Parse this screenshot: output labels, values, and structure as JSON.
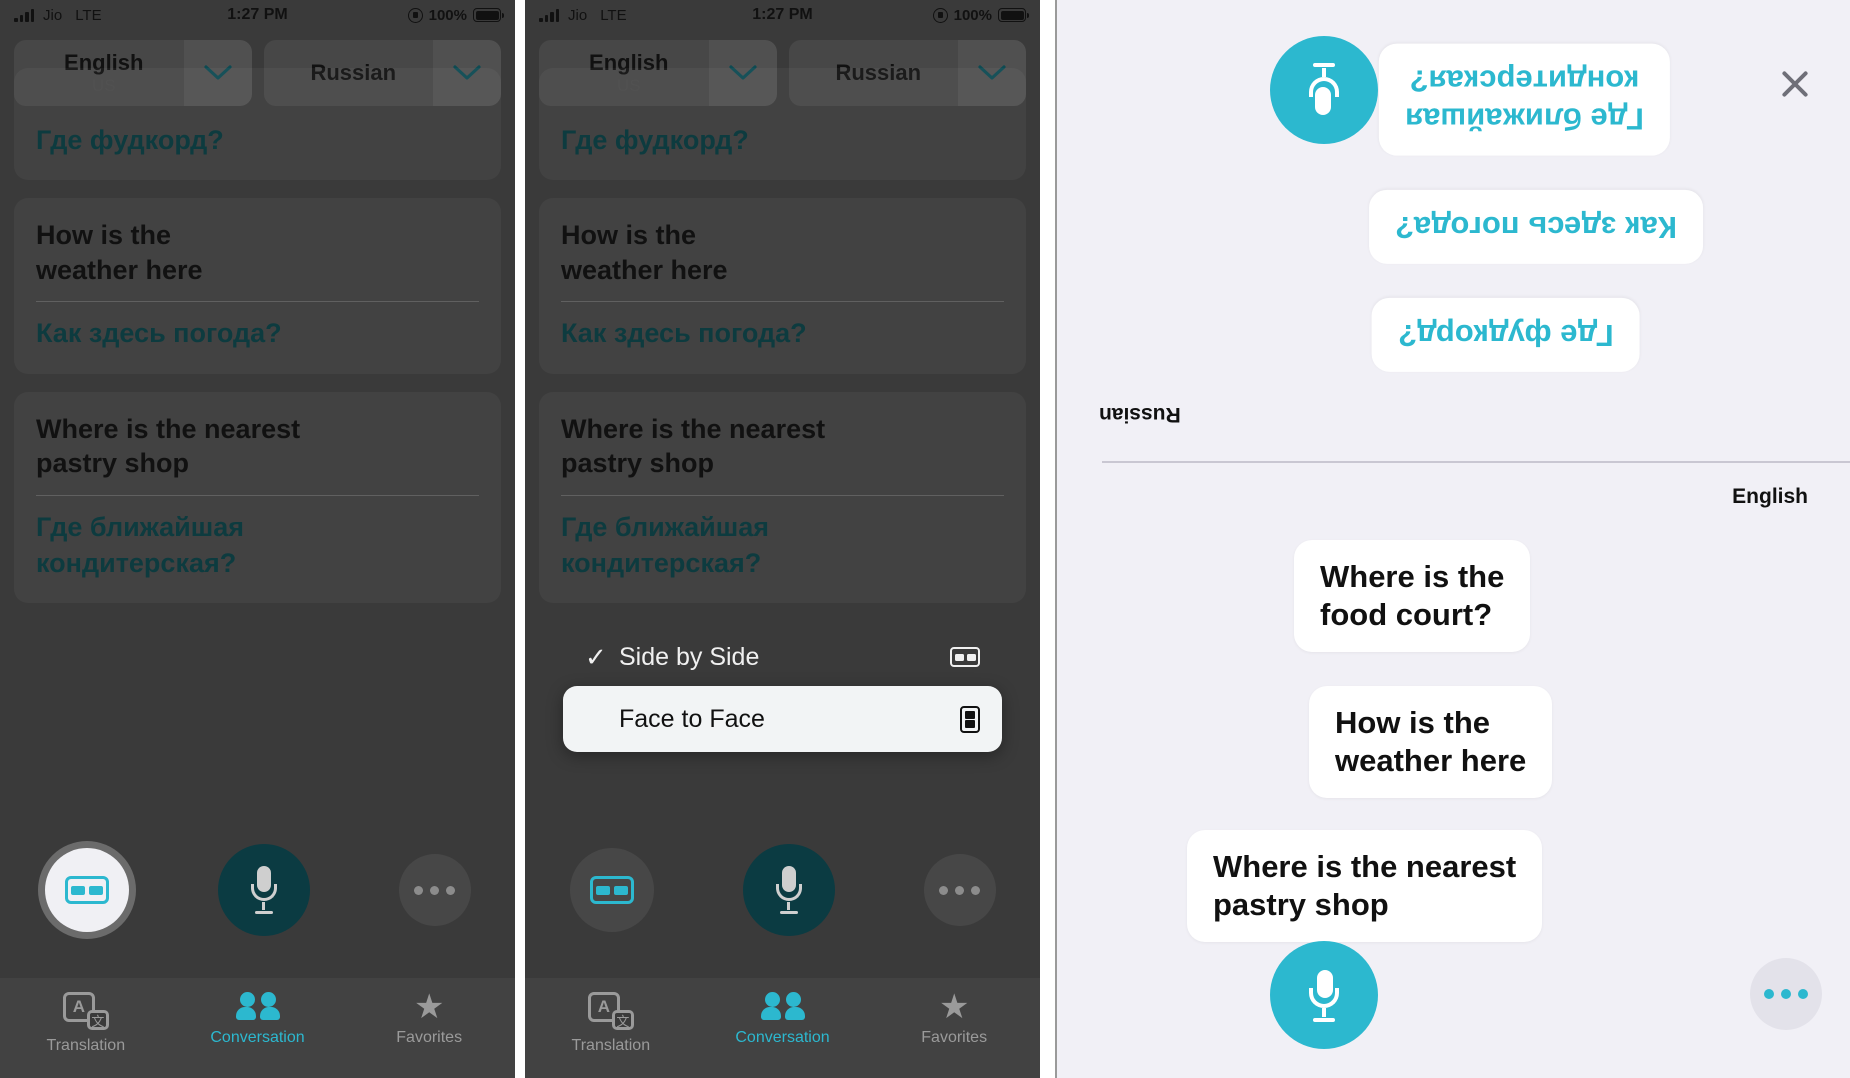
{
  "status_bar": {
    "carrier": "Jio",
    "network": "LTE",
    "time": "1:27 PM",
    "battery_percent": "100%",
    "signal_icon": "signal-bars-icon",
    "lock_icon": "rotation-lock-icon",
    "battery_icon": "battery-full-icon"
  },
  "language_selector": {
    "source": {
      "name": "English",
      "region": "US"
    },
    "target": {
      "name": "Russian",
      "region": ""
    },
    "chevron_icon": "chevron-down-icon"
  },
  "conversation": {
    "cards": [
      {
        "english": "Where is the food court?",
        "russian": "Где фудкорд?"
      },
      {
        "english": "How is the\nweather here",
        "russian": "Как здесь погода?"
      },
      {
        "english": "Where is the nearest\npastry shop",
        "russian": "Где ближайшая\nкондитерская?"
      }
    ],
    "clipped_russian": "Где фудкорд?"
  },
  "actions": {
    "side_by_side_icon": "side-by-side-icon",
    "mic_icon": "microphone-icon",
    "more_icon": "more-options-icon"
  },
  "tab_bar": {
    "tabs": [
      {
        "label": "Translation",
        "icon": "translation-icon",
        "active": false
      },
      {
        "label": "Conversation",
        "icon": "people-icon",
        "active": true
      },
      {
        "label": "Favorites",
        "icon": "star-icon",
        "active": false
      }
    ]
  },
  "context_menu": {
    "items": [
      {
        "label": "Side by Side",
        "checked": true,
        "icon": "side-by-side-icon",
        "selected": false
      },
      {
        "label": "Face to Face",
        "checked": false,
        "icon": "face-to-face-icon",
        "selected": true
      }
    ],
    "check_glyph": "✓"
  },
  "face_to_face": {
    "close_icon": "close-icon",
    "mic_icon": "microphone-icon",
    "more_icon": "more-options-icon",
    "top_language_label": "Russian",
    "bottom_language_label": "English",
    "top_bubbles": [
      {
        "text": "Где ближайшая\nкондитерская?"
      },
      {
        "text": "Как здесь погода?"
      },
      {
        "text": "Где фудкорд?"
      }
    ],
    "bottom_bubbles": [
      {
        "text": "Where is the\nfood court?"
      },
      {
        "text": "How is the\nweather here"
      },
      {
        "text": "Where is the nearest\npastry shop"
      }
    ]
  },
  "colors": {
    "accent_cyan": "#2cb8cf",
    "accent_teal_dark": "#0b3b42",
    "panel_bg": "#3a3a3a",
    "f2f_bg": "#f1f0f6"
  }
}
